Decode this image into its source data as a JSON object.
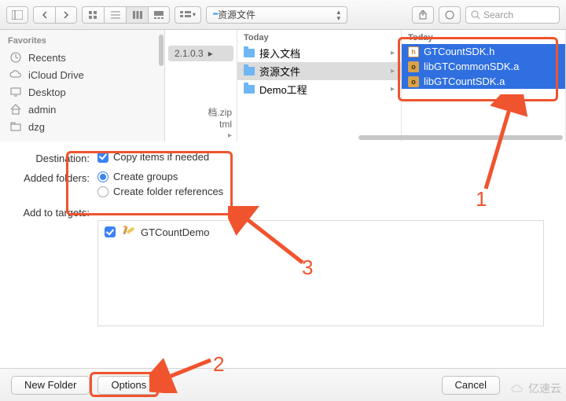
{
  "toolbar": {
    "path_label": "资源文件",
    "search_placeholder": "Search"
  },
  "sidebar": {
    "section": "Favorites",
    "items": [
      {
        "label": "Recents",
        "icon": "clock-icon"
      },
      {
        "label": "iCloud Drive",
        "icon": "cloud-icon"
      },
      {
        "label": "Desktop",
        "icon": "desktop-icon"
      },
      {
        "label": "admin",
        "icon": "home-icon"
      },
      {
        "label": "dzg",
        "icon": "folder-icon"
      }
    ]
  },
  "columns": {
    "col0": {
      "pill_label": "2.1.0.3",
      "partial_lines": [
        "档.zip",
        "tml"
      ]
    },
    "col1": {
      "header": "Today",
      "rows": [
        {
          "label": "接入文档",
          "selected": false
        },
        {
          "label": "资源文件",
          "selected": true
        },
        {
          "label": "Demo工程",
          "selected": false
        }
      ]
    },
    "col2": {
      "header": "Today",
      "rows": [
        {
          "label": "GTCountSDK.h",
          "badge": "h"
        },
        {
          "label": "libGTCommonSDK.a",
          "badge": "o"
        },
        {
          "label": "libGTCountSDK.a",
          "badge": "o"
        }
      ]
    }
  },
  "options": {
    "destination_label": "Destination:",
    "copy_items_label": "Copy items if needed",
    "added_folders_label": "Added folders:",
    "create_groups_label": "Create groups",
    "create_refs_label": "Create folder references",
    "add_targets_label": "Add to targets:",
    "target_name": "GTCountDemo"
  },
  "footer": {
    "new_folder": "New Folder",
    "options": "Options",
    "cancel": "Cancel"
  },
  "annotations": {
    "one": "1",
    "two": "2",
    "three": "3"
  },
  "watermark": "亿速云"
}
